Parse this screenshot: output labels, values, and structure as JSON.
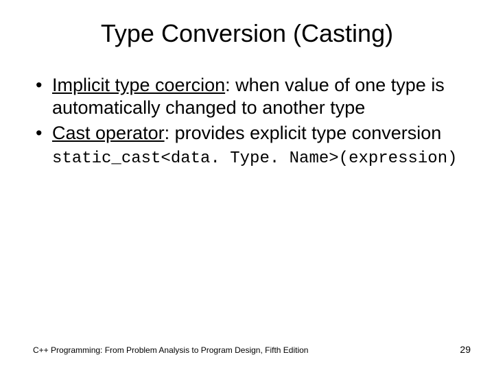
{
  "title": "Type Conversion (Casting)",
  "bullets": [
    {
      "term": "Implicit type coercion",
      "rest": ": when value of one type is automatically changed to another type"
    },
    {
      "term": "Cast operator",
      "rest": ": provides explicit type conversion"
    }
  ],
  "code_line": "static_cast<data. Type. Name>(expression)",
  "footer": {
    "left": "C++ Programming: From Problem Analysis to Program Design, Fifth Edition",
    "page": "29"
  }
}
